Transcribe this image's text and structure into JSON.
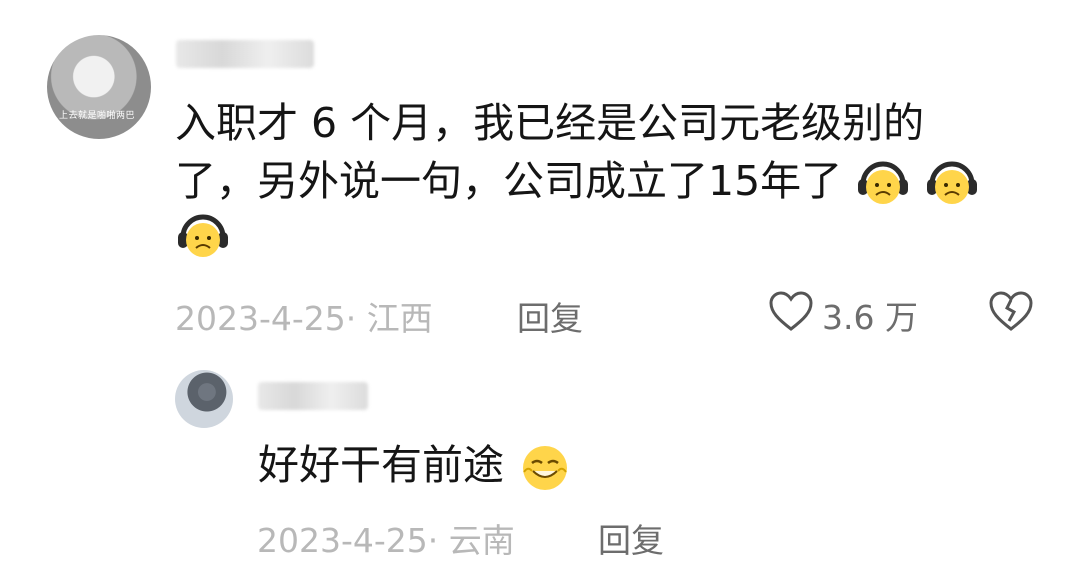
{
  "comment": {
    "avatar_caption": "上去就是啪啪两巴",
    "text_line1": "入职才 6 个月，我已经是公司元老级别的",
    "text_line2": "了，另外说一句，公司成立了15年了",
    "emoji_name": "headphones-frown-emoji",
    "meta": "2023-4-25· 江西",
    "reply_label": "回复",
    "like_count": "3.6 万"
  },
  "reply": {
    "text": "好好干有前途",
    "emoji_name": "grinning-laugh-emoji",
    "meta": "2023-4-25· 云南",
    "reply_label": "回复"
  },
  "colors": {
    "text": "#151515",
    "meta": "#b8b8b8",
    "action": "#6d6d6d"
  },
  "icons": {
    "like": "heart-outline-icon",
    "dislike": "broken-heart-icon"
  }
}
